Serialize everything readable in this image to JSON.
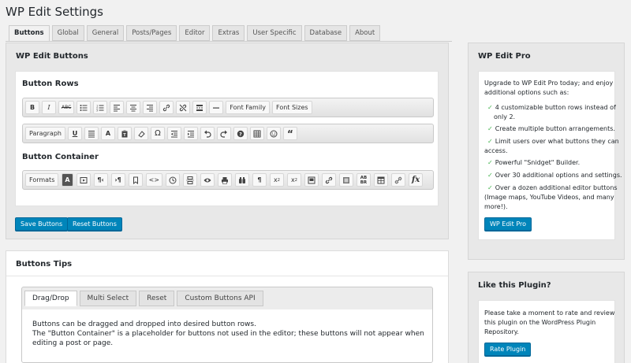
{
  "page_title": "WP Edit Settings",
  "tabs": [
    "Buttons",
    "Global",
    "General",
    "Posts/Pages",
    "Editor",
    "Extras",
    "User Specific",
    "Database",
    "About"
  ],
  "buttons_panel": {
    "title": "WP Edit Buttons",
    "rows_heading": "Button Rows",
    "row1": [
      "bold-icon",
      "italic-icon",
      "strikethrough-icon",
      "bullet-list-icon",
      "numbered-list-icon",
      "align-left-icon",
      "align-center-icon",
      "align-right-icon",
      "link-icon",
      "unlink-icon",
      "read-more-icon",
      "horizontal-line-icon"
    ],
    "row1_text": [
      "Font Family",
      "Font Sizes"
    ],
    "row2_text": "Paragraph",
    "row2": [
      "underline-icon",
      "justify-icon",
      "text-color-icon",
      "paste-text-icon",
      "clear-format-icon",
      "special-char-icon",
      "outdent-icon",
      "indent-icon",
      "undo-icon",
      "redo-icon",
      "help-icon",
      "table-icon",
      "emoticon-icon",
      "blockquote-icon"
    ],
    "container_heading": "Button Container",
    "container_text": "Formats",
    "container": [
      "font-color-icon",
      "media-icon",
      "ltr-icon",
      "rtl-icon",
      "anchor-icon",
      "code-icon",
      "time-icon",
      "page-break-icon",
      "preview-icon",
      "print-icon",
      "search-replace-icon",
      "nonbreaking-icon",
      "subscript-icon",
      "superscript-icon",
      "image-icon",
      "link2-icon",
      "image2-icon",
      "abbr-icon",
      "table2-icon",
      "unlink2-icon",
      "formula-icon"
    ],
    "save_label": "Save Buttons",
    "reset_label": "Reset Buttons"
  },
  "tips_panel": {
    "title": "Buttons Tips",
    "subtabs": [
      "Drag/Drop",
      "Multi Select",
      "Reset",
      "Custom Buttons API"
    ],
    "line1": "Buttons can be dragged and dropped into desired button rows.",
    "line2": "The \"Button Container\" is a placeholder for buttons not used in the editor; these buttons will not appear when",
    "line3": "editing a post or page."
  },
  "pro_panel": {
    "title": "WP Edit Pro",
    "intro1": "Upgrade to WP Edit Pro today; and enjoy",
    "intro2": "additional options such as:",
    "f1a": "4 customizable button rows instead of",
    "f1b": "only 2.",
    "f2": "Create multiple button arrangements.",
    "f3a": "Limit users over what buttons they can",
    "f3b": "access.",
    "f4": "Powerful \"Snidget\" Builder.",
    "f5": "Over 30 additional options and settings.",
    "f6a": "Over a dozen additional editor buttons",
    "f6b": "(Image maps, YouTube Videos, and many",
    "f6c": "more!).",
    "button": "WP Edit Pro"
  },
  "like_panel": {
    "title": "Like this Plugin?",
    "t1": "Please take a moment to rate and review",
    "t2": "this plugin on the WordPress Plugin",
    "t3": "Repository.",
    "button": "Rate Plugin"
  },
  "colors": {
    "accent": "#0085ba",
    "check": "#46b450"
  }
}
